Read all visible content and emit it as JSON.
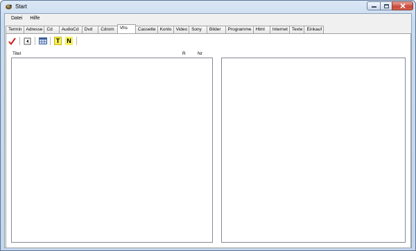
{
  "window": {
    "title": "Start",
    "icon": "app-icon"
  },
  "menu": {
    "items": [
      "Datei",
      "Hilfe"
    ]
  },
  "tabs": {
    "items": [
      "Termin",
      "Adresse",
      "Cd",
      "AudioCd",
      "Dvd",
      "Cdrom",
      "Vhs",
      "Cassette",
      "Konto",
      "Video",
      "Sony",
      "Bilder",
      "Programme",
      "Html",
      "Internet",
      "Texte",
      "Einkauf"
    ],
    "active": "Vhs"
  },
  "toolbar": {
    "check_icon": "checkmark-icon",
    "back_icon": "back-arrow-icon",
    "grid_icon": "table-icon",
    "t_label": "T",
    "n_label": "N"
  },
  "list": {
    "col_titel": "Titel",
    "col_r": "R",
    "col_nr": "Nr"
  },
  "colors": {
    "accent_check": "#d0201a",
    "highlight": "#f6f15a"
  }
}
